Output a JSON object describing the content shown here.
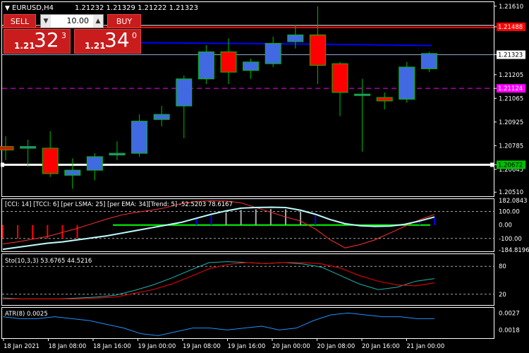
{
  "header": {
    "symbol_tf": "EURUSD,H4",
    "ohlc": "1.21232 1.21329 1.21222 1.21323"
  },
  "trade_panel": {
    "sell_label": "SELL",
    "buy_label": "BUY",
    "lot_value": "10.00",
    "sell_price": {
      "prefix": "1.21",
      "big": "32",
      "sup": "3"
    },
    "buy_price": {
      "prefix": "1.21",
      "big": "34",
      "sup": "0"
    }
  },
  "colors": {
    "bg": "#000000",
    "bull": "#4169e1",
    "bear": "#ff0000",
    "wick": "#00c000",
    "grid": "#ffffff",
    "ma": "#0000ff",
    "accent": "#c91c1c"
  },
  "price_axis": {
    "ticks": [
      "1.21610",
      "1.21488",
      "1.21323",
      "1.21205",
      "1.21124",
      "1.21065",
      "1.20925",
      "1.20785",
      "1.20672",
      "1.20645",
      "1.20510"
    ],
    "min": 1.2049,
    "max": 1.2163,
    "tags": [
      {
        "label": "1.21488",
        "value": 1.21488,
        "bg": "#ff0000",
        "fg": "#ffffff"
      },
      {
        "label": "1.21323",
        "value": 1.21323,
        "bg": "#ffffff",
        "fg": "#000000"
      },
      {
        "label": "1.21124",
        "value": 1.21124,
        "bg": "#ff00ff",
        "fg": "#ffffff"
      },
      {
        "label": "1.20672",
        "value": 1.20672,
        "bg": "#00c000",
        "fg": "#000000"
      }
    ]
  },
  "lines": {
    "resistance": 1.21488,
    "support": 1.20672,
    "pivot": 1.21124,
    "ma_level": 1.2139
  },
  "candles": [
    {
      "o": 1.2078,
      "h": 1.2084,
      "l": 1.207,
      "c": 1.2076
    },
    {
      "o": 1.2077,
      "h": 1.2082,
      "l": 1.2066,
      "c": 1.2078
    },
    {
      "o": 1.2077,
      "h": 1.2087,
      "l": 1.206,
      "c": 1.2062
    },
    {
      "o": 1.2061,
      "h": 1.2071,
      "l": 1.2053,
      "c": 1.2064
    },
    {
      "o": 1.2064,
      "h": 1.2074,
      "l": 1.2058,
      "c": 1.2072
    },
    {
      "o": 1.2073,
      "h": 1.2081,
      "l": 1.207,
      "c": 1.2074
    },
    {
      "o": 1.2074,
      "h": 1.2097,
      "l": 1.2072,
      "c": 1.2093
    },
    {
      "o": 1.2094,
      "h": 1.2102,
      "l": 1.209,
      "c": 1.2097
    },
    {
      "o": 1.2102,
      "h": 1.212,
      "l": 1.2083,
      "c": 1.2118
    },
    {
      "o": 1.2118,
      "h": 1.2138,
      "l": 1.2115,
      "c": 1.2134
    },
    {
      "o": 1.2134,
      "h": 1.2142,
      "l": 1.2115,
      "c": 1.2122
    },
    {
      "o": 1.2123,
      "h": 1.213,
      "l": 1.2118,
      "c": 1.2128
    },
    {
      "o": 1.2127,
      "h": 1.2143,
      "l": 1.2125,
      "c": 1.2139
    },
    {
      "o": 1.214,
      "h": 1.215,
      "l": 1.2136,
      "c": 1.2144
    },
    {
      "o": 1.2144,
      "h": 1.2161,
      "l": 1.2115,
      "c": 1.2126
    },
    {
      "o": 1.2127,
      "h": 1.2128,
      "l": 1.2096,
      "c": 1.211
    },
    {
      "o": 1.2109,
      "h": 1.2118,
      "l": 1.2075,
      "c": 1.2109
    },
    {
      "o": 1.2107,
      "h": 1.211,
      "l": 1.21,
      "c": 1.2105
    },
    {
      "o": 1.2106,
      "h": 1.2128,
      "l": 1.2104,
      "c": 1.2125
    },
    {
      "o": 1.2124,
      "h": 1.2134,
      "l": 1.2122,
      "c": 1.2133
    }
  ],
  "cci": {
    "label": "[CCI: 14] [TCCI: 6] [per LSMA: 25] [per EMA: 34][Trend: 5] -52.5203 78.6167",
    "ticks": [
      "182.0843",
      "100.00",
      "0.00",
      "-100.00",
      "-184.8196"
    ],
    "min": -184.8196,
    "max": 182.0843,
    "cci_values": [
      -140,
      -125,
      -105,
      -85,
      -55,
      -25,
      10,
      45,
      75,
      95,
      110,
      130,
      160,
      175,
      180,
      178,
      165,
      130,
      95,
      60,
      30,
      -30,
      -110,
      -170,
      -145,
      -110,
      -60,
      -10,
      40,
      78
    ],
    "tcci_values": [
      -180,
      -165,
      -150,
      -135,
      -125,
      -110,
      -95,
      -80,
      -60,
      -40,
      -20,
      0,
      20,
      50,
      80,
      105,
      125,
      130,
      132,
      130,
      110,
      80,
      40,
      10,
      -5,
      -10,
      -8,
      5,
      30,
      60
    ],
    "hist": [
      -1,
      -1,
      -1,
      -1,
      -1,
      -1,
      0,
      0,
      0,
      0,
      0,
      0,
      0,
      1,
      1,
      1,
      1,
      1,
      1,
      1,
      1,
      1,
      0,
      0,
      0,
      0,
      0,
      1,
      1,
      1
    ]
  },
  "stoch": {
    "label": "Sto(10,3,3) 53.6765 44.5216",
    "ticks": [
      "80",
      "20"
    ],
    "main": [
      12,
      10,
      10,
      10,
      12,
      14,
      18,
      28,
      40,
      55,
      72,
      88,
      90,
      88,
      86,
      88,
      85,
      78,
      60,
      42,
      30,
      35,
      48,
      53.6765
    ],
    "signal": [
      10,
      10,
      10,
      10,
      10,
      12,
      14,
      22,
      30,
      42,
      58,
      75,
      84,
      88,
      86,
      88,
      88,
      85,
      76,
      60,
      48,
      40,
      38,
      44.5216
    ]
  },
  "atr": {
    "label": "ATR(8) 0.0025",
    "ticks": [
      "0.0027",
      "0.0018"
    ],
    "min": 0.0014,
    "max": 0.0029,
    "values": [
      0.0025,
      0.0024,
      0.0024,
      0.0025,
      0.0024,
      0.0023,
      0.0021,
      0.0019,
      0.0016,
      0.0015,
      0.0017,
      0.0019,
      0.0019,
      0.0018,
      0.0019,
      0.002,
      0.0018,
      0.0019,
      0.0023,
      0.0026,
      0.0027,
      0.0026,
      0.0025,
      0.0025,
      0.0024,
      0.0024
    ]
  },
  "time_axis": [
    "18 Jan 2021",
    "18 Jan 08:00",
    "18 Jan 16:00",
    "19 Jan 00:00",
    "19 Jan 08:00",
    "19 Jan 16:00",
    "20 Jan 00:00",
    "20 Jan 08:00",
    "20 Jan 16:00",
    "21 Jan 00:00"
  ]
}
